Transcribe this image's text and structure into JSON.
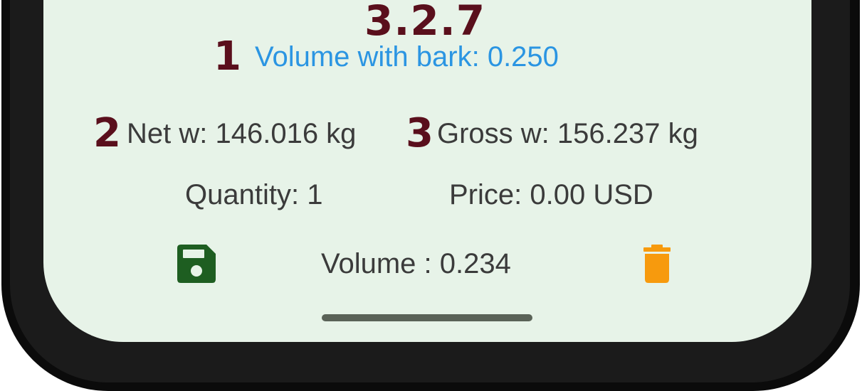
{
  "annotations": {
    "section": "3.2.7",
    "marker_1": "1",
    "marker_2": "2",
    "marker_3": "3"
  },
  "summary": {
    "volume_with_bark": "Volume with bark: 0.250",
    "net_weight": "Net w: 146.016 kg",
    "gross_weight": "Gross w: 156.237 kg",
    "quantity": "Quantity: 1",
    "price": "Price: 0.00 USD",
    "volume": "Volume : 0.234"
  },
  "icons": {
    "save": "floppy-disk-icon",
    "delete": "trash-icon"
  },
  "colors": {
    "screen_background": "#e7f3e8",
    "annotation": "#5a0f1c",
    "accent_blue": "#2b95e2",
    "save_green": "#1e5e21",
    "delete_orange": "#f79a0d",
    "text_gray": "#3b3b3b"
  }
}
